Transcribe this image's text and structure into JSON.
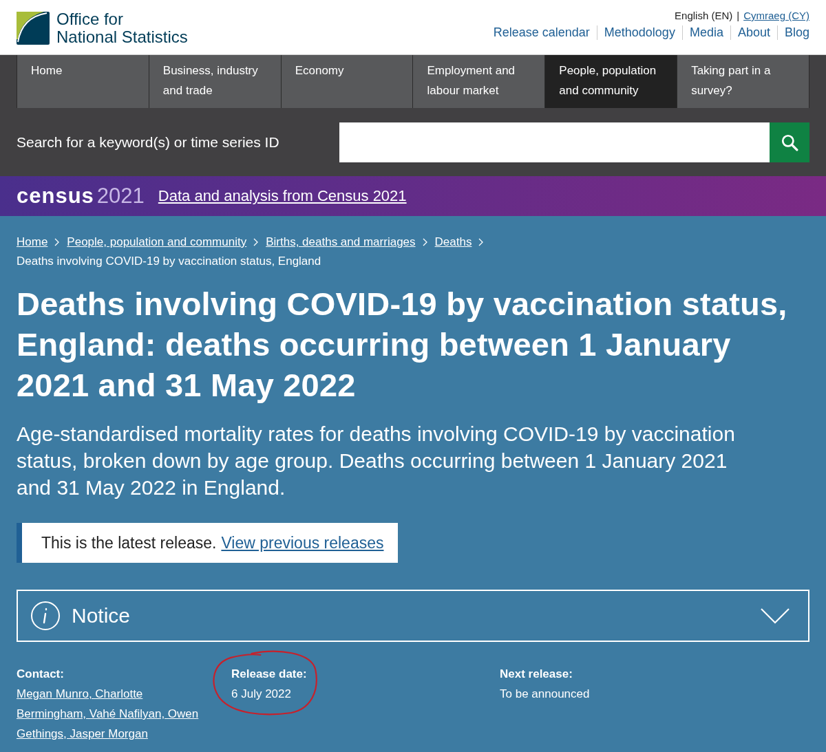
{
  "header": {
    "logo_line_1": "Office for",
    "logo_line_2": "National Statistics",
    "language_separator": "|",
    "languages": [
      {
        "label": "English (EN)",
        "selected": true
      },
      {
        "label": "Cymraeg (CY)",
        "selected": false
      }
    ],
    "links": [
      "Release calendar",
      "Methodology",
      "Media",
      "About",
      "Blog"
    ]
  },
  "nav": [
    {
      "label": "Home",
      "selected": false
    },
    {
      "label": "Business, industry and trade",
      "selected": false
    },
    {
      "label": "Economy",
      "selected": false
    },
    {
      "label": "Employment and labour market",
      "selected": false
    },
    {
      "label": "People, population and community",
      "selected": true
    },
    {
      "label": "Taking part in a survey?",
      "selected": false
    }
  ],
  "search": {
    "label": "Search for a keyword(s) or time series ID"
  },
  "census_banner": {
    "logo_word": "census",
    "logo_year": "2021",
    "link": "Data and analysis from Census 2021"
  },
  "breadcrumbs": [
    "Home",
    "People, population and community",
    "Births, deaths and marriages",
    "Deaths"
  ],
  "current_page": "Deaths involving COVID-19 by vaccination status, England",
  "title": "Deaths involving COVID-19 by vaccination status, England: deaths occurring between 1 January 2021 and 31 May 2022",
  "summary": "Age-standardised mortality rates for deaths involving COVID-19 by vaccination status, broken down by age group. Deaths occurring between 1 January 2021 and 31 May 2022 in England.",
  "release_notice": {
    "text": "This is the latest release.",
    "link": "View previous releases"
  },
  "notice": {
    "label": "Notice",
    "expanded": false
  },
  "meta": [
    {
      "label": "Contact:",
      "value": "Megan Munro, Charlotte Bermingham, Vahé Nafilyan, Owen Gethings, Jasper Morgan",
      "kind": "link",
      "circled": false
    },
    {
      "label": "Release date:",
      "value": "6 July 2022",
      "kind": "text",
      "circled": true
    },
    {
      "label": "Next release:",
      "value": "To be announced",
      "kind": "text",
      "circled": false
    }
  ]
}
